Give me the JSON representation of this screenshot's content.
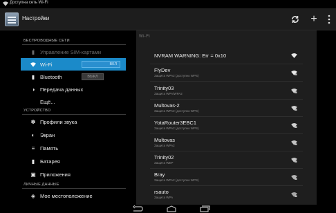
{
  "status_bar": {
    "notification": "Доступна сеть Wi-Fi"
  },
  "action_bar": {
    "title": "Настройки"
  },
  "left": {
    "sections": [
      {
        "header": "БЕСПРОВОДНЫЕ СЕТИ"
      },
      {
        "header": "УСТРОЙСТВО"
      },
      {
        "header": "ЛИЧНЫЕ ДАННЫЕ"
      }
    ],
    "items": [
      {
        "label": "Управление SIM-картами",
        "icon": "sim-card-icon"
      },
      {
        "label": "Wi-Fi",
        "icon": "wifi-icon",
        "toggle": "ВКЛ",
        "selected": true
      },
      {
        "label": "Bluetooth",
        "icon": "bluetooth-icon",
        "toggle": "ВЫКЛ"
      },
      {
        "label": "Передача данных",
        "icon": "data-usage-icon"
      },
      {
        "label": "Ещё..."
      },
      {
        "label": "Профили звука",
        "icon": "sound-icon"
      },
      {
        "label": "Экран",
        "icon": "display-icon"
      },
      {
        "label": "Память",
        "icon": "storage-icon"
      },
      {
        "label": "Батарея",
        "icon": "battery-icon"
      },
      {
        "label": "Приложения",
        "icon": "apps-icon"
      },
      {
        "label": "Мое местоположение",
        "icon": "location-icon"
      }
    ]
  },
  "wifi": {
    "header": "Wi-Fi",
    "networks": [
      {
        "ssid": "NVRAM WARNING: Err = 0x10",
        "security": ""
      },
      {
        "ssid": "FlyDev",
        "security": "Защита WPA2 (доступно WPS)"
      },
      {
        "ssid": "Trinity03",
        "security": "Защита WPA/WPA2"
      },
      {
        "ssid": "Multovas-2",
        "security": "Защита WPA2 (доступно WPS)"
      },
      {
        "ssid": "YotaRouter3EBC1",
        "security": "Защита WPA2 (доступно WPS)"
      },
      {
        "ssid": "Multovas",
        "security": "Защита WPA2"
      },
      {
        "ssid": "Trinity02",
        "security": "Защита WEP"
      },
      {
        "ssid": "Bray",
        "security": "Защита WPA2 (доступно WPS)"
      },
      {
        "ssid": "rsauto",
        "security": "Защита WPA"
      }
    ]
  },
  "colors": {
    "accent": "#1b8ac9",
    "background": "#000000",
    "pane": "#1e1e1e"
  }
}
